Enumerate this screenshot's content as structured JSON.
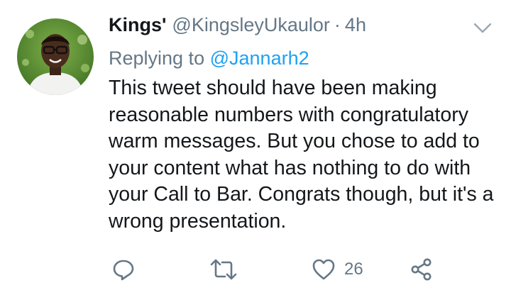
{
  "tweet": {
    "author_name": "Kings'",
    "author_handle": "@KingsleyUkaulor",
    "separator": "·",
    "time": "4h",
    "reply_prefix": "Replying to",
    "reply_mention": "@Jannarh2",
    "text": "This tweet should have been making reasonable numbers with congratulatory warm messages. But you chose to add to your content what has nothing to do with your Call to Bar. Congrats though, but it's a wrong presentation."
  },
  "actions": {
    "reply_icon": "reply-icon",
    "retweet_icon": "retweet-icon",
    "like_icon": "heart-icon",
    "like_count": "26",
    "share_icon": "share-icon"
  },
  "colors": {
    "text": "#14171a",
    "secondary": "#657786",
    "link": "#1da1f2"
  }
}
